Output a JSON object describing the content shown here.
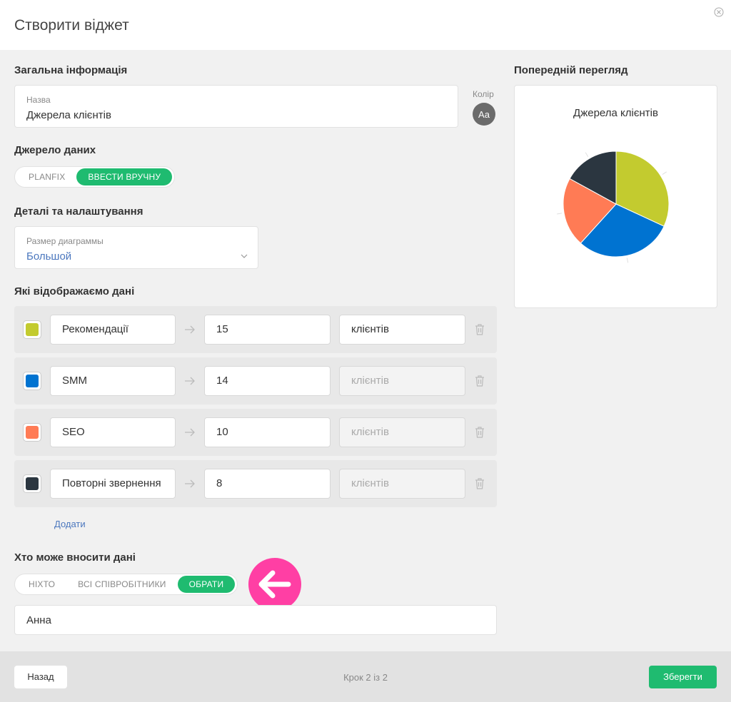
{
  "header": {
    "title": "Створити віджет"
  },
  "general": {
    "heading": "Загальна інформація",
    "name_label": "Назва",
    "name_value": "Джерела клієнтів",
    "color_label": "Колір",
    "color_button": "Aa"
  },
  "source": {
    "heading": "Джерело даних",
    "options": [
      "PLANFIX",
      "ВВЕСТИ ВРУЧНУ"
    ],
    "selected": "ВВЕСТИ ВРУЧНУ"
  },
  "details": {
    "heading": "Деталі та налаштування",
    "size_label": "Размер диаграммы",
    "size_value": "Большой"
  },
  "data_section": {
    "heading": "Які відображаємо дані",
    "rows": [
      {
        "name": "Рекомендації",
        "value": "15",
        "unit": "клієнтів",
        "color": "#c3cb2f",
        "unit_enabled": true
      },
      {
        "name": "SMM",
        "value": "14",
        "unit": "клієнтів",
        "color": "#0073d1",
        "unit_enabled": false
      },
      {
        "name": "SEO",
        "value": "10",
        "unit": "клієнтів",
        "color": "#ff7b55",
        "unit_enabled": false
      },
      {
        "name": "Повторні звернення",
        "value": "8",
        "unit": "клієнтів",
        "color": "#2b3640",
        "unit_enabled": false
      }
    ],
    "add_label": "Додати"
  },
  "access": {
    "heading": "Хто може вносити дані",
    "options": [
      "НІХТО",
      "ВСІ СПІВРОБІТНИКИ",
      "ОБРАТИ"
    ],
    "selected": "ОБРАТИ",
    "selected_user": "Анна"
  },
  "preview": {
    "heading": "Попередній перегляд"
  },
  "chart_data": {
    "type": "pie",
    "title": "Джерела клієнтів",
    "categories": [
      "Рекомендації",
      "SMM",
      "SEO",
      "Повторні звернення"
    ],
    "values": [
      15,
      14,
      10,
      8
    ],
    "colors": [
      "#c3cb2f",
      "#0073d1",
      "#ff7b55",
      "#2b3640"
    ]
  },
  "footer": {
    "back_label": "Назад",
    "step_text": "Крок 2 із 2",
    "save_label": "Зберегти"
  }
}
